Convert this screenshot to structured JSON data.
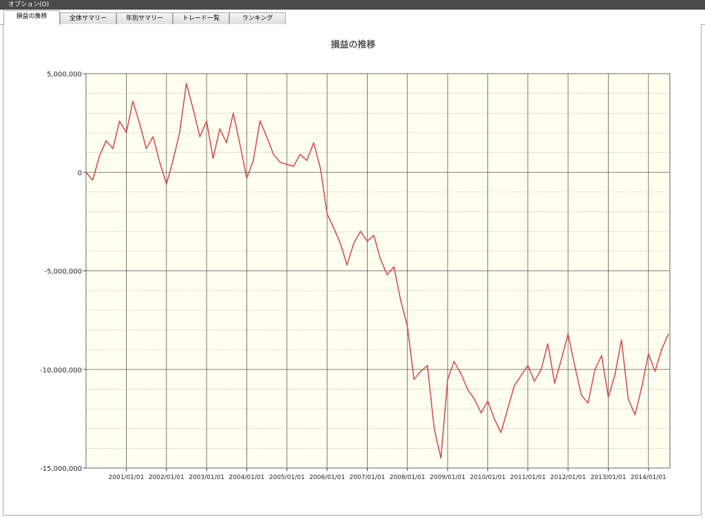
{
  "window": {
    "title": "オプション(O)"
  },
  "tabs": [
    {
      "label": "損益の推移",
      "active": true
    },
    {
      "label": "全体サマリー",
      "active": false
    },
    {
      "label": "年別サマリー",
      "active": false
    },
    {
      "label": "トレード一覧",
      "active": false
    },
    {
      "label": "ランキング",
      "active": false
    }
  ],
  "chart_data": {
    "type": "line",
    "title": "損益の推移",
    "xlabel": "",
    "ylabel": "",
    "ylim": [
      -15000000,
      5000000
    ],
    "xlim": [
      "2000/01/01",
      "2014/07/15"
    ],
    "y_ticks": [
      "5,000,000",
      "0",
      "-5,000,000",
      "-10,000,000",
      "-15,000,000"
    ],
    "y_tick_values": [
      5000000,
      0,
      -5000000,
      -10000000,
      -15000000
    ],
    "x_ticks": [
      "2001/01/01",
      "2002/01/01",
      "2003/01/01",
      "2004/01/01",
      "2005/01/01",
      "2006/01/01",
      "2007/01/01",
      "2008/01/01",
      "2009/01/01",
      "2010/01/01",
      "2011/01/01",
      "2012/01/01",
      "2013/01/01",
      "2014/01/01"
    ],
    "grid": true,
    "legend": "none",
    "colors": {
      "line": "#d05050",
      "plot_bg": "#fffff0",
      "grid_major": "#555555",
      "grid_minor": "#b8b8b8"
    },
    "x": [
      "2000/01/01",
      "2000/03/01",
      "2000/05/01",
      "2000/07/01",
      "2000/09/01",
      "2000/11/01",
      "2001/01/01",
      "2001/03/01",
      "2001/05/01",
      "2001/07/01",
      "2001/09/01",
      "2001/11/01",
      "2002/01/01",
      "2002/03/01",
      "2002/05/01",
      "2002/07/01",
      "2002/09/01",
      "2002/11/01",
      "2003/01/01",
      "2003/03/01",
      "2003/05/01",
      "2003/07/01",
      "2003/09/01",
      "2003/11/01",
      "2004/01/01",
      "2004/03/01",
      "2004/05/01",
      "2004/07/01",
      "2004/09/01",
      "2004/11/01",
      "2005/01/01",
      "2005/03/01",
      "2005/05/01",
      "2005/07/01",
      "2005/09/01",
      "2005/11/01",
      "2006/01/01",
      "2006/03/01",
      "2006/05/01",
      "2006/07/01",
      "2006/09/01",
      "2006/11/01",
      "2007/01/01",
      "2007/03/01",
      "2007/05/01",
      "2007/07/01",
      "2007/09/01",
      "2007/11/01",
      "2008/01/01",
      "2008/03/01",
      "2008/05/01",
      "2008/07/01",
      "2008/09/01",
      "2008/11/01",
      "2009/01/01",
      "2009/03/01",
      "2009/05/01",
      "2009/07/01",
      "2009/09/01",
      "2009/11/01",
      "2010/01/01",
      "2010/03/01",
      "2010/05/01",
      "2010/07/01",
      "2010/09/01",
      "2010/11/01",
      "2011/01/01",
      "2011/03/01",
      "2011/05/01",
      "2011/07/01",
      "2011/09/01",
      "2011/11/01",
      "2012/01/01",
      "2012/03/01",
      "2012/05/01",
      "2012/07/01",
      "2012/09/01",
      "2012/11/01",
      "2013/01/01",
      "2013/03/01",
      "2013/05/01",
      "2013/07/01",
      "2013/09/01",
      "2013/11/01",
      "2014/01/01",
      "2014/03/01",
      "2014/05/01",
      "2014/07/01"
    ],
    "values": [
      0,
      -400000,
      800000,
      1600000,
      1200000,
      2600000,
      2000000,
      3600000,
      2500000,
      1200000,
      1800000,
      500000,
      -600000,
      600000,
      2000000,
      4500000,
      3200000,
      1800000,
      2600000,
      700000,
      2200000,
      1500000,
      3000000,
      1400000,
      -300000,
      600000,
      2600000,
      1800000,
      900000,
      500000,
      400000,
      300000,
      900000,
      600000,
      1500000,
      200000,
      -2100000,
      -2800000,
      -3600000,
      -4700000,
      -3600000,
      -3000000,
      -3500000,
      -3200000,
      -4400000,
      -5200000,
      -4800000,
      -6500000,
      -7800000,
      -10500000,
      -10100000,
      -9800000,
      -13000000,
      -14500000,
      -10500000,
      -9600000,
      -10200000,
      -11000000,
      -11500000,
      -12200000,
      -11600000,
      -12500000,
      -13200000,
      -12000000,
      -10800000,
      -10300000,
      -9800000,
      -10600000,
      -10000000,
      -8700000,
      -10700000,
      -9500000,
      -8200000,
      -9800000,
      -11300000,
      -11700000,
      -10000000,
      -9300000,
      -11400000,
      -10300000,
      -8500000,
      -11500000,
      -12300000,
      -10900000,
      -9200000,
      -10100000,
      -9000000,
      -8200000
    ]
  }
}
